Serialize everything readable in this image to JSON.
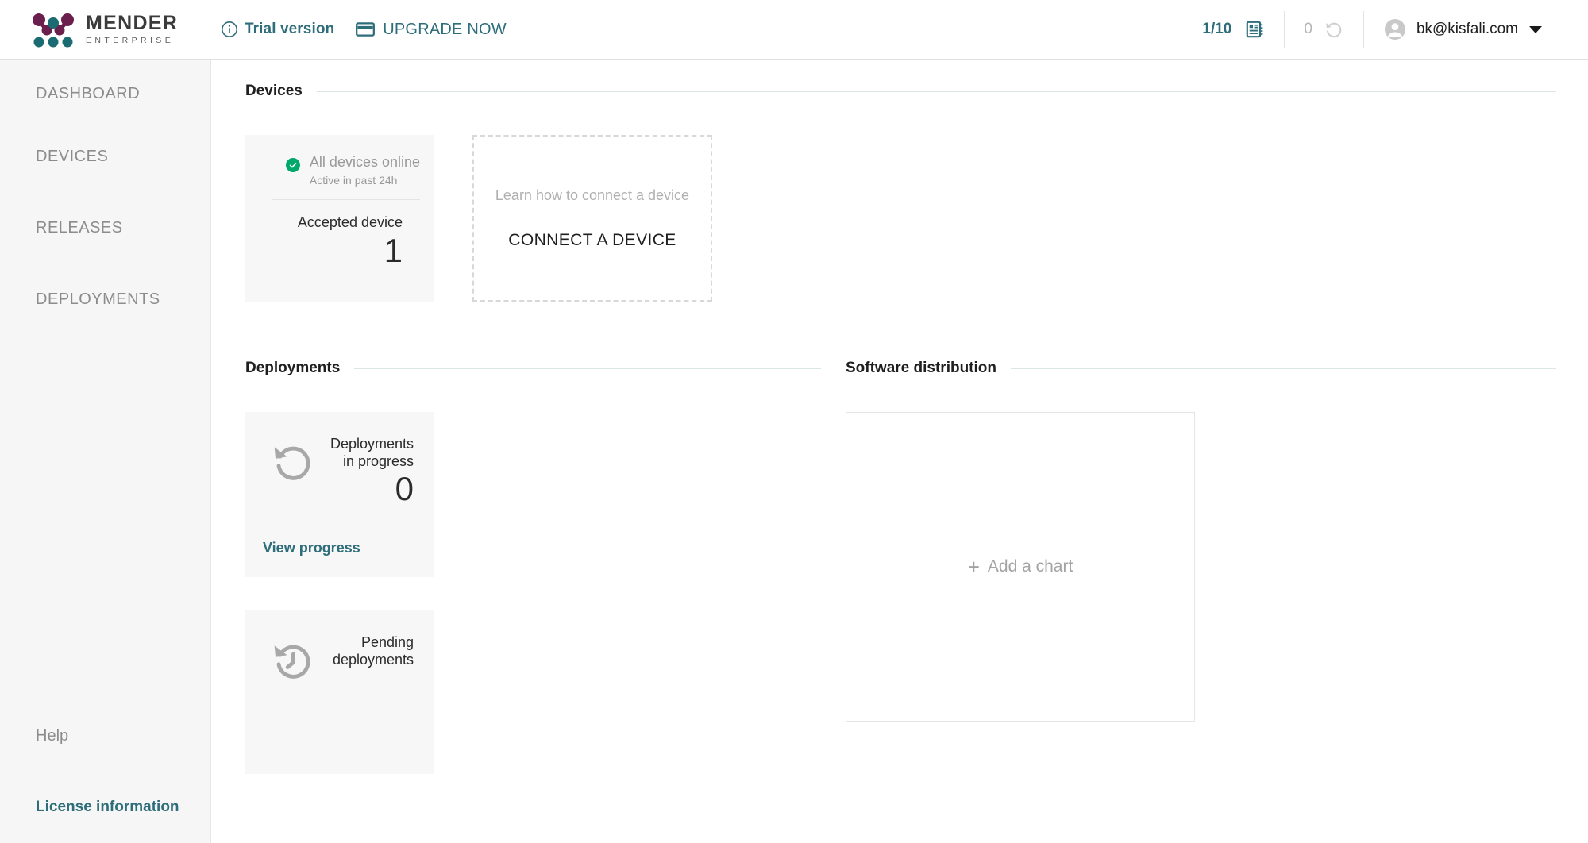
{
  "header": {
    "logo": {
      "title": "MENDER",
      "subtitle": "ENTERPRISE",
      "icon": "mender-logo-icon"
    },
    "trial": {
      "info_icon": "info-circle-icon",
      "label": "Trial version",
      "card_icon": "credit-card-icon",
      "upgrade_label": "UPGRADE NOW"
    },
    "device_limit": {
      "value": "1/10",
      "icon": "microchip-icon"
    },
    "pending_count": {
      "value": "0",
      "icon": "history-rotate-icon"
    },
    "account": {
      "avatar_icon": "account-circle-icon",
      "email": "bk@kisfali.com",
      "caret_icon": "chevron-down-icon"
    }
  },
  "sidebar": {
    "items": [
      {
        "label": "DASHBOARD"
      },
      {
        "label": "DEVICES"
      },
      {
        "label": "RELEASES"
      },
      {
        "label": "DEPLOYMENTS"
      }
    ],
    "bottom": {
      "help_label": "Help",
      "license_label": "License information"
    }
  },
  "main": {
    "devices": {
      "section_title": "Devices",
      "tile": {
        "status_icon": "check-circle-icon",
        "status_main": "All devices online",
        "status_sub": "Active in past 24h",
        "label": "Accepted device",
        "value": "1"
      },
      "connect": {
        "subtitle": "Learn how to connect a device",
        "button_label": "CONNECT A DEVICE"
      }
    },
    "deployments": {
      "section_title": "Deployments",
      "in_progress": {
        "icon": "rotate-left-icon",
        "label_line1": "Deployments",
        "label_line2": "in progress",
        "value": "0",
        "link_label": "View progress"
      },
      "pending": {
        "icon": "history-clock-icon",
        "label_line1": "Pending",
        "label_line2": "deployments"
      }
    },
    "software_distribution": {
      "section_title": "Software distribution",
      "add_chart_label": "Add a chart",
      "plus_icon": "plus-icon"
    }
  },
  "colors": {
    "teal": "#2e6d7a",
    "logo_purple": "#6b1f4d",
    "logo_teal": "#1a6b72",
    "green": "#00a86b",
    "sidebar_bg": "#f6f6f6",
    "tile_bg": "#f7f7f7",
    "rule": "#d9e7e7"
  }
}
